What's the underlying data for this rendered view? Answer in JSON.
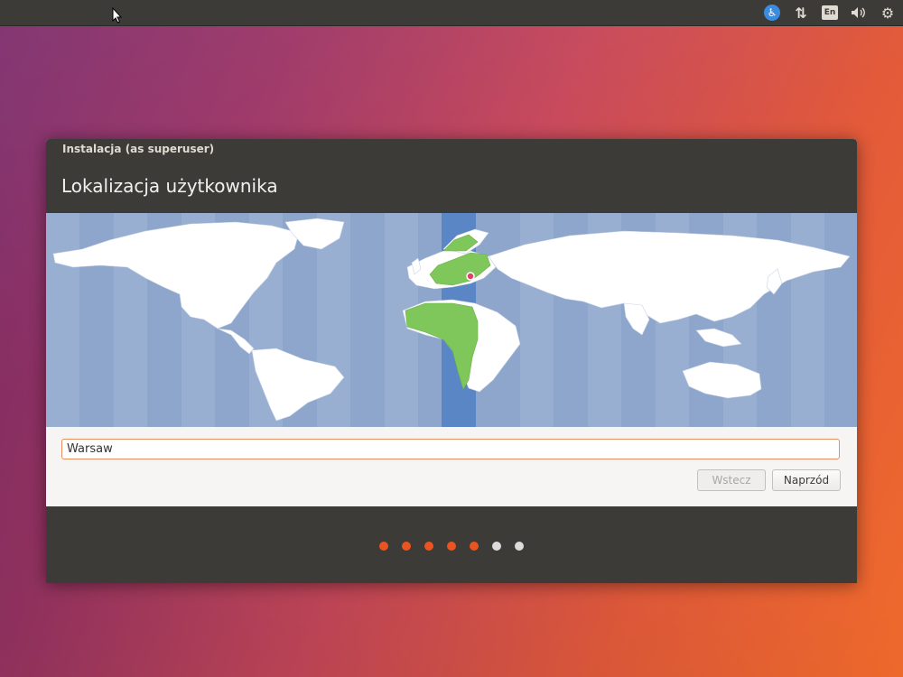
{
  "topbar": {
    "tray_icons": [
      {
        "name": "accessibility-icon",
        "glyph": "♿"
      },
      {
        "name": "network-icon",
        "glyph": "⇅"
      },
      {
        "name": "keyboard-layout-indicator",
        "label": "En"
      },
      {
        "name": "volume-icon",
        "glyph": "🔊"
      },
      {
        "name": "settings-gear-icon",
        "glyph": "⚙"
      }
    ]
  },
  "window": {
    "title": "Instalacja (as superuser)",
    "page_title": "Lokalizacja użytkownika"
  },
  "location": {
    "city_value": "Warsaw"
  },
  "buttons": {
    "back_label": "Wstecz",
    "next_label": "Naprzód"
  },
  "progress": {
    "total_steps": 7,
    "completed_steps": 5,
    "active_color": "#e95420",
    "inactive_color": "#dcdcdc"
  },
  "colors": {
    "accent": "#e95420",
    "timezone_band": "#5a86c5",
    "timezone_highlight": "#7fc75a",
    "ocean": "#8ea6cc"
  }
}
